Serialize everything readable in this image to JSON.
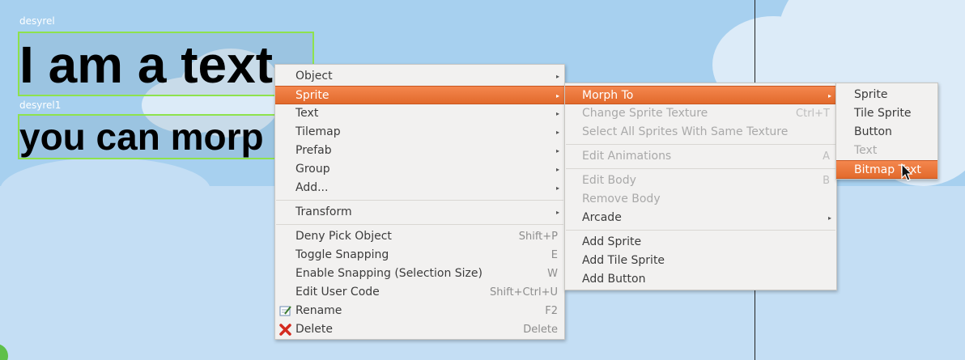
{
  "objects": [
    {
      "name": "desyrel",
      "text": "I am a text"
    },
    {
      "name": "desyrel1",
      "text": "you can morp"
    }
  ],
  "context_menu": {
    "items": [
      {
        "label": "Object",
        "submenu": true
      },
      {
        "label": "Sprite",
        "submenu": true,
        "highlighted": true
      },
      {
        "label": "Text",
        "submenu": true
      },
      {
        "label": "Tilemap",
        "submenu": true
      },
      {
        "label": "Prefab",
        "submenu": true
      },
      {
        "label": "Group",
        "submenu": true
      },
      {
        "label": "Add...",
        "submenu": true
      },
      {
        "label": "Transform",
        "submenu": true
      },
      {
        "label": "Deny Pick Object",
        "shortcut": "Shift+P"
      },
      {
        "label": "Toggle Snapping",
        "shortcut": "E"
      },
      {
        "label": "Enable Snapping (Selection Size)",
        "shortcut": "W"
      },
      {
        "label": "Edit User Code",
        "shortcut": "Shift+Ctrl+U"
      },
      {
        "label": "Rename",
        "shortcut": "F2",
        "icon": "rename-icon"
      },
      {
        "label": "Delete",
        "shortcut": "Delete",
        "icon": "delete-icon"
      }
    ]
  },
  "sprite_menu": {
    "items": [
      {
        "label": "Morph To",
        "submenu": true,
        "highlighted": true
      },
      {
        "label": "Change Sprite Texture",
        "shortcut": "Ctrl+T",
        "disabled": true
      },
      {
        "label": "Select All Sprites With Same Texture",
        "disabled": true
      },
      {
        "label": "Edit Animations",
        "shortcut": "A",
        "disabled": true
      },
      {
        "label": "Edit Body",
        "shortcut": "B",
        "disabled": true
      },
      {
        "label": "Remove Body",
        "disabled": true
      },
      {
        "label": "Arcade",
        "submenu": true
      },
      {
        "label": "Add Sprite"
      },
      {
        "label": "Add Tile Sprite"
      },
      {
        "label": "Add Button"
      }
    ]
  },
  "morph_menu": {
    "items": [
      {
        "label": "Sprite"
      },
      {
        "label": "Tile Sprite"
      },
      {
        "label": "Button"
      },
      {
        "label": "Text",
        "disabled": true
      },
      {
        "label": "Bitmap Text",
        "highlighted": true
      }
    ]
  },
  "colors": {
    "highlight": "#e8703a",
    "selection_border": "#8ee24d",
    "sky": "#a7d0ef"
  }
}
